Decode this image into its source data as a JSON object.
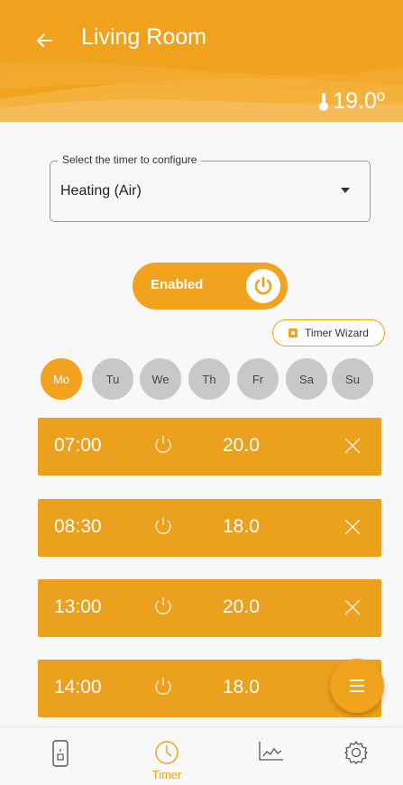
{
  "header": {
    "title": "Living Room",
    "temperature": "19.0º",
    "icons": {
      "back": "arrow-left-icon",
      "thermometer": "thermometer-icon"
    }
  },
  "timer_select": {
    "legend": "Select the timer to configure",
    "value": "Heating (Air)"
  },
  "toggle": {
    "label": "Enabled",
    "icon": "power-icon"
  },
  "wizard": {
    "label": "Timer Wizard",
    "icon": "wizard-icon"
  },
  "days": [
    {
      "label": "Mo",
      "active": true
    },
    {
      "label": "Tu",
      "active": false
    },
    {
      "label": "We",
      "active": false
    },
    {
      "label": "Th",
      "active": false
    },
    {
      "label": "Fr",
      "active": false
    },
    {
      "label": "Sa",
      "active": false
    },
    {
      "label": "Su",
      "active": false
    }
  ],
  "schedule": [
    {
      "time": "07:00",
      "temp": "20.0"
    },
    {
      "time": "08:30",
      "temp": "18.0"
    },
    {
      "time": "13:00",
      "temp": "20.0"
    },
    {
      "time": "14:00",
      "temp": "18.0"
    }
  ],
  "bottom_nav": {
    "items": [
      {
        "name": "device",
        "icon": "device-icon",
        "label": ""
      },
      {
        "name": "timer",
        "icon": "clock-icon",
        "label": "Timer",
        "active": true
      },
      {
        "name": "stats",
        "icon": "chart-icon",
        "label": ""
      },
      {
        "name": "settings",
        "icon": "gear-icon",
        "label": ""
      }
    ]
  },
  "colors": {
    "accent": "#f2a31e",
    "row": "#eca11e",
    "day_inactive": "#c8c8c8"
  }
}
